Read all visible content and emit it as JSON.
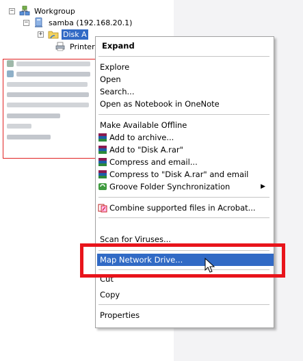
{
  "tree": {
    "workgroup_label": "Workgroup",
    "samba_label": "samba (192.168.20.1)",
    "disk_label": "Disk A",
    "printer_label": "Printer"
  },
  "context_menu": {
    "expand": "Expand",
    "explore": "Explore",
    "open": "Open",
    "search": "Search...",
    "open_onenote": "Open as Notebook in OneNote",
    "offline": "Make Available Offline",
    "add_archive": "Add to archive...",
    "add_rar": "Add to \"Disk A.rar\"",
    "compress_email": "Compress and email...",
    "compress_rar_email": "Compress to \"Disk A.rar\" and email",
    "groove": "Groove Folder Synchronization",
    "acrobat": "Combine supported files in Acrobat...",
    "scan": "Scan for Viruses...",
    "map_drive": "Map Network Drive...",
    "cut": "Cut",
    "copy": "Copy",
    "properties": "Properties"
  },
  "colors": {
    "selection": "#316ac5",
    "highlight_box": "#e8141b"
  },
  "icons": {
    "workgroup": "network-group-icon",
    "samba": "computer-icon",
    "disk": "shared-folder-icon",
    "printer": "printer-icon",
    "archive": "winrar-icon",
    "groove": "groove-icon",
    "acrobat": "acrobat-icon"
  }
}
